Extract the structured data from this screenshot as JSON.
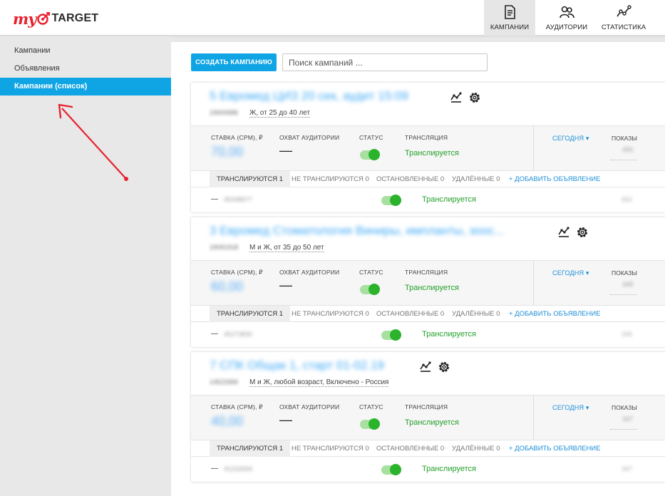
{
  "header": {
    "logo_my": "my",
    "logo_target": "TARGET",
    "nav": [
      {
        "label": "КАМПАНИИ",
        "icon": "campaigns-icon",
        "active": true
      },
      {
        "label": "АУДИТОРИИ",
        "icon": "audiences-icon",
        "active": false
      },
      {
        "label": "СТАТИСТИКА",
        "icon": "statistics-icon",
        "active": false
      }
    ]
  },
  "sidebar": {
    "items": [
      {
        "label": "Кампании",
        "active": false
      },
      {
        "label": "Объявления",
        "active": false
      },
      {
        "label": "Кампании (список)",
        "active": true
      }
    ]
  },
  "toolbar": {
    "create_label": "СОЗДАТЬ КАМПАНИЮ",
    "search_placeholder": "Поиск кампаний ..."
  },
  "labels": {
    "rate": "СТАВКА (CPM), ₽",
    "reach": "ОХВАТ АУДИТОРИИ",
    "status": "СТАТУС",
    "translation": "ТРАНСЛЯЦИЯ",
    "period": "СЕГОДНЯ ▾",
    "shows": "ПОКАЗЫ",
    "reach_value": "—",
    "ad_dash": "—"
  },
  "campaigns": [
    {
      "title": "5 Евромед ЦИЗ 20 сек, аудит 15:09",
      "id": "19000686",
      "audience": "Ж, от 25 до 40 лет",
      "rate": "70,00",
      "status_text": "Транслируется",
      "shows": "456",
      "tabs": {
        "active": "ТРАНСЛИРУЮТСЯ 1",
        "inactive": "НЕ ТРАНСЛИРУЮТСЯ 0",
        "stopped": "ОСТАНОВЛЕННЫЕ 0",
        "deleted": "УДАЛЁННЫЕ 0",
        "add": "+ ДОБАВИТЬ ОБЪЯВЛЕНИЕ"
      },
      "ad": {
        "id": "45348677",
        "status_text": "Транслируется",
        "shows": "832"
      }
    },
    {
      "title": "3 Евромед Стоматология Виниры, импланты, зоос...",
      "id": "19091918",
      "audience": "М и Ж, от 35 до 50 лет",
      "rate": "60,00",
      "status_text": "Транслируется",
      "shows": "348",
      "tabs": {
        "active": "ТРАНСЛИРУЮТСЯ 1",
        "inactive": "НЕ ТРАНСЛИРУЮТСЯ 0",
        "stopped": "ОСТАНОВЛЕННЫЕ 0",
        "deleted": "УДАЛЁННЫЕ 0",
        "add": "+ ДОБАВИТЬ ОБЪЯВЛЕНИЕ"
      },
      "ad": {
        "id": "45273830",
        "status_text": "Транслируется",
        "shows": "345"
      }
    },
    {
      "title": "7 СПК Общак 1, старт 01-02.19",
      "id": "14523366",
      "audience": "М и Ж, любой возраст, Включено - Россия",
      "rate": "40,00",
      "status_text": "Транслируется",
      "shows": "347",
      "tabs": {
        "active": "ТРАНСЛИРУЮТСЯ 1",
        "inactive": "НЕ ТРАНСЛИРУЮТСЯ 0",
        "stopped": "ОСТАНОВЛЕННЫЕ 0",
        "deleted": "УДАЛЁННЫЕ 0",
        "add": "+ ДОБАВИТЬ ОБЪЯВЛЕНИЕ"
      },
      "ad": {
        "id": "41232694",
        "status_text": "Транслируется",
        "shows": "347"
      }
    }
  ],
  "colors": {
    "accent": "#0fa5e5",
    "brand_red": "#e8212d",
    "status_green": "#22a02a",
    "link_blue": "#1a8ed6"
  }
}
